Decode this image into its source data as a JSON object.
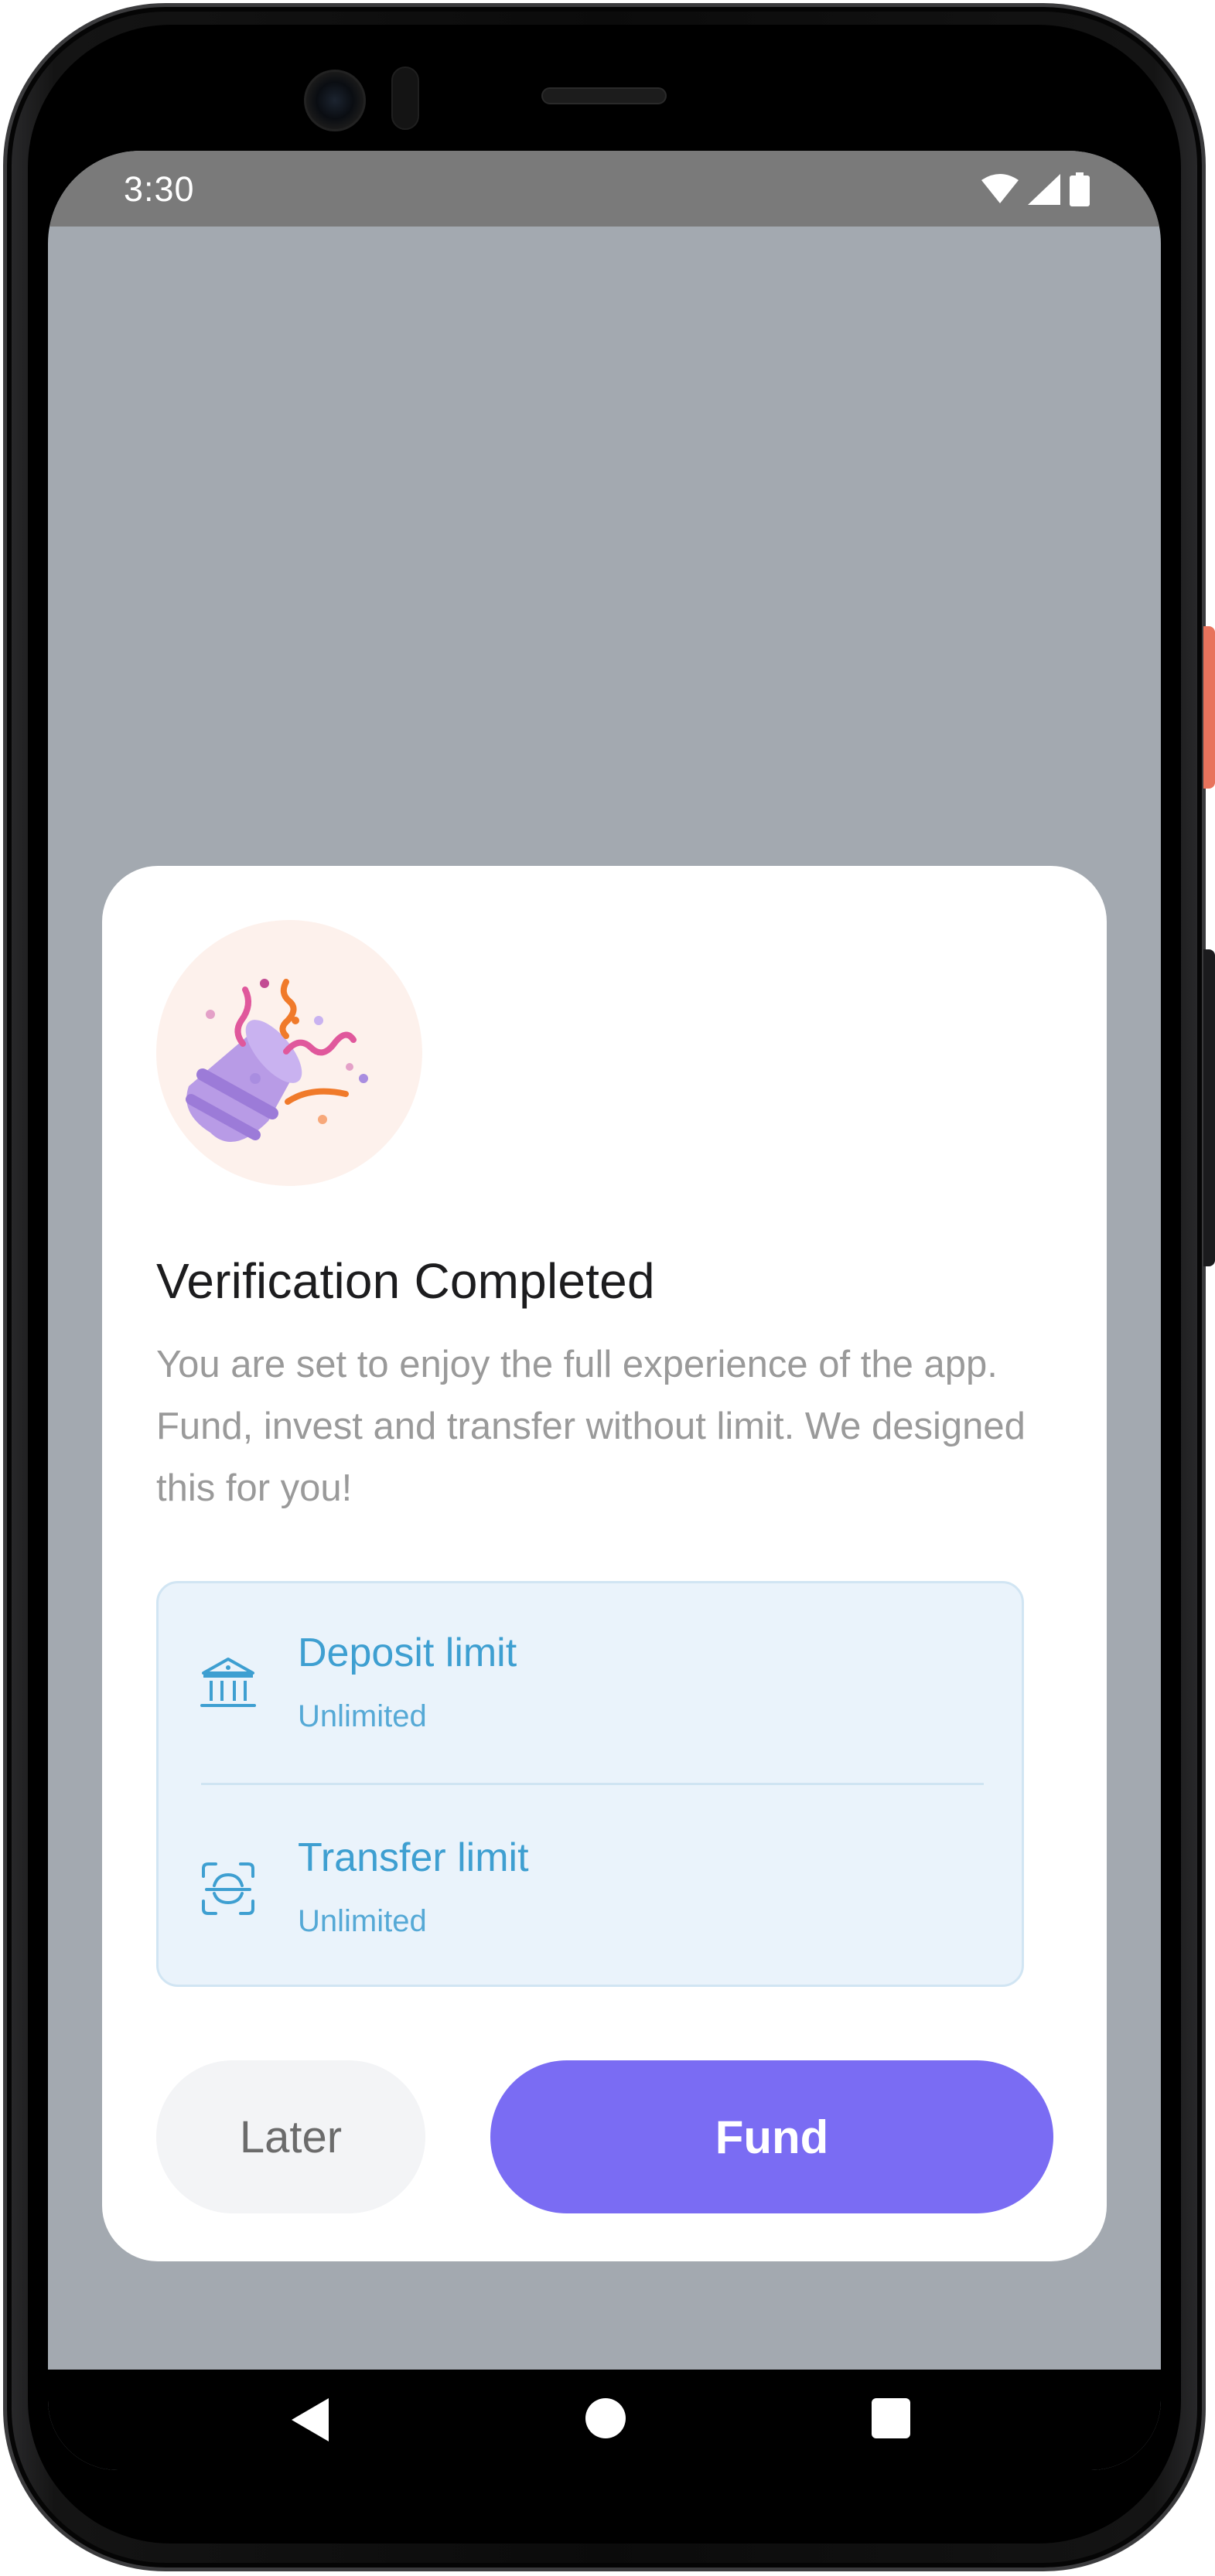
{
  "status_bar": {
    "time": "3:30",
    "icons": [
      "wifi-icon",
      "cellular-signal-icon",
      "battery-icon"
    ]
  },
  "dialog": {
    "illustration": "party-popper-icon",
    "title": "Verification Completed",
    "description": "You are set to enjoy the full experience of the app. Fund, invest and transfer without limit. We designed this for you!",
    "limits": [
      {
        "icon": "bank-icon",
        "label": "Deposit limit",
        "value": "Unlimited"
      },
      {
        "icon": "transfer-scan-icon",
        "label": "Transfer limit",
        "value": "Unlimited"
      }
    ],
    "later_label": "Later",
    "fund_label": "Fund"
  },
  "navigation": {
    "buttons": [
      "back-icon",
      "home-icon",
      "recents-icon"
    ]
  },
  "colors": {
    "primary": "#7a6cf3",
    "info_text": "#3e9fd1",
    "info_bg": "#eaf3fb",
    "scrim": "#a3a9b0"
  }
}
